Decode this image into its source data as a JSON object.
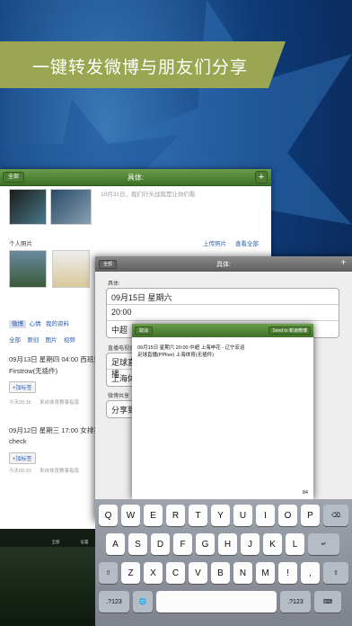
{
  "banner": {
    "text": "一键转发微博与朋友们分享"
  },
  "panel1": {
    "back": "全部",
    "title": "具体:",
    "plus": "+",
    "top_text": "10月31日，我们行头战就是让你们看",
    "section_photos": "个人照片",
    "upload": "上传照片",
    "view_all": "查看全部",
    "tabs1": [
      "微博",
      "心情",
      "我的资料"
    ],
    "tabs2": [
      "全部",
      "原创",
      "图片",
      "视频"
    ],
    "post1": "09月13日 星期四 04:00 西班牙",
    "post1b": "Firstrow(无插件)",
    "tag": "+加标签",
    "time1": "今天00:36",
    "source": "来自体育赛事指南",
    "post2": "09月12日 星期三 17:00 女排实",
    "post2b": "check",
    "time2": "今天00:33"
  },
  "dock": {
    "label1": "全部",
    "label2": "设置"
  },
  "panel2": {
    "back": "全部",
    "title": "具体:",
    "plus": "+",
    "label1": "具体:",
    "rows1": [
      "09月15日 星期六",
      "20:00",
      "中超"
    ],
    "label2": "直播电视台",
    "rows2": [
      "足球直播",
      "上海体"
    ],
    "label3": "微博共享",
    "rows3": [
      "分享到"
    ]
  },
  "dialog": {
    "cancel": "取消",
    "send": "Send to 新浪微博",
    "line1": "09月15日 星期六 20:00  中超 上海申花 - 辽宁宏运",
    "line2": "足球直播(PPlive) 上海体育(无插件)",
    "count": "84"
  },
  "keyboard": {
    "row1": [
      "Q",
      "W",
      "E",
      "R",
      "T",
      "Y",
      "U",
      "I",
      "O",
      "P",
      "⌫"
    ],
    "row2": [
      "A",
      "S",
      "D",
      "F",
      "G",
      "H",
      "J",
      "K",
      "L",
      "↵"
    ],
    "row3": [
      "⇧",
      "Z",
      "X",
      "C",
      "V",
      "B",
      "N",
      "M",
      "!",
      ",",
      "⇧"
    ],
    "row4": [
      ".?123",
      "🌐",
      " ",
      ".?123",
      "⌨"
    ]
  }
}
